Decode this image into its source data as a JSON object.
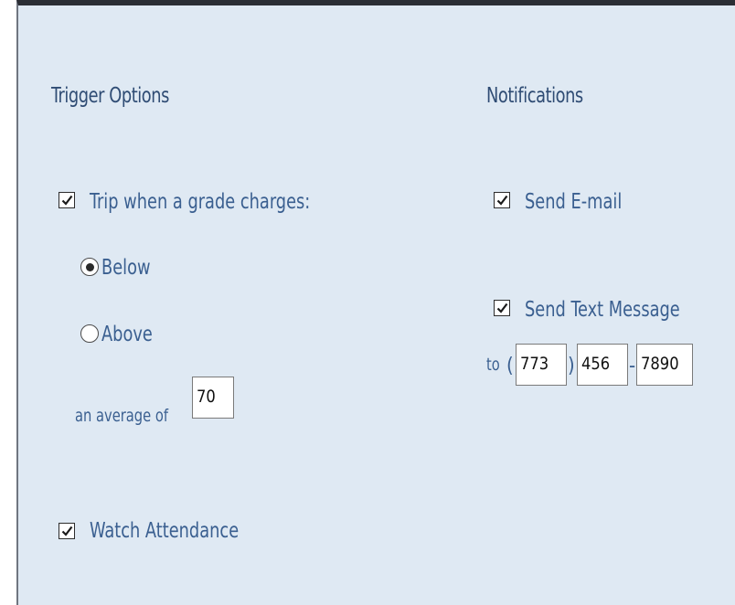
{
  "trigger_options": {
    "heading": "Trigger Options",
    "trip_checkbox": {
      "label": "Trip when a grade charges:",
      "checked": true
    },
    "direction": {
      "options": [
        {
          "label": "Below",
          "selected": true
        },
        {
          "label": "Above",
          "selected": false
        }
      ]
    },
    "average_label": "an average of",
    "average_value": "70",
    "attendance_checkbox": {
      "label": "Watch Attendance",
      "checked": true
    }
  },
  "notifications": {
    "heading": "Notifications",
    "email_checkbox": {
      "label": "Send E-mail",
      "checked": true
    },
    "text_checkbox": {
      "label": "Send Text Message",
      "checked": true
    },
    "phone": {
      "prefix": "to",
      "open_paren": "(",
      "close_paren": ")",
      "dash": "-",
      "area_code": "773",
      "exchange": "456",
      "line": "7890"
    }
  },
  "colors": {
    "panel_background": "#dfe9f3",
    "heading_text": "#2f4c74",
    "label_text": "#3a5f90"
  }
}
